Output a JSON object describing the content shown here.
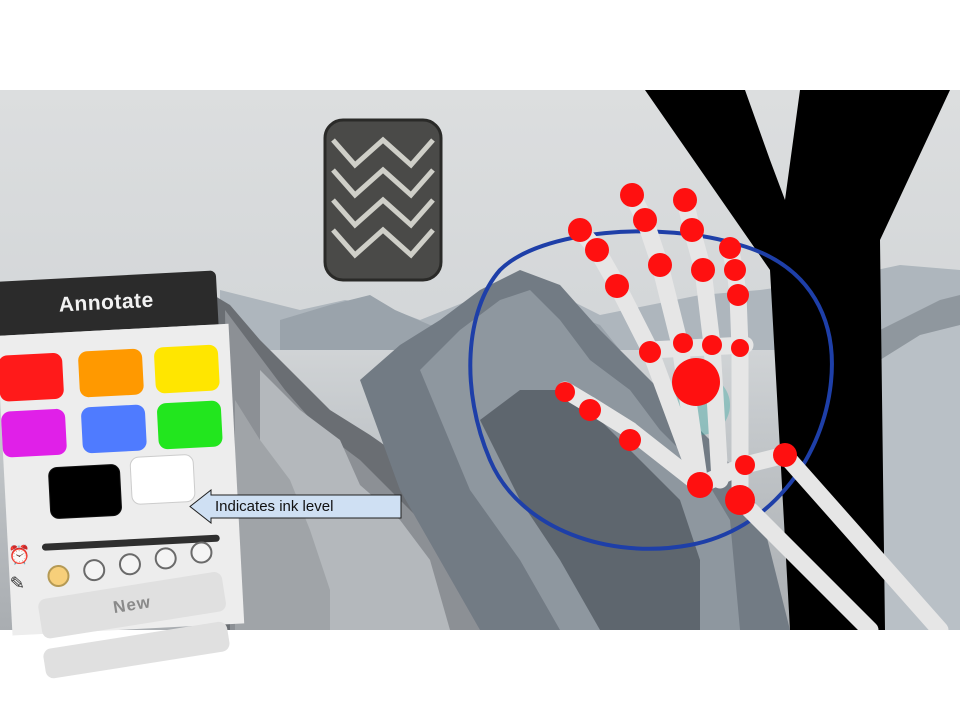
{
  "panel": {
    "title": "Annotate",
    "colors": [
      "#ff1a1a",
      "#ff9900",
      "#ffe600",
      "#e020e8",
      "#4f7bff",
      "#22e61e",
      "#000000",
      "#ffffff"
    ],
    "ink_level": 1.0,
    "pen_sizes_selected_index": 0,
    "new_label": "New"
  },
  "callout": {
    "text": "Indicates ink level"
  },
  "colors": {
    "panel_header": "#2b2b2b",
    "panel_body": "#ededed",
    "callout_fill": "#cfe0f3",
    "callout_stroke": "#1f1f1f",
    "hand_joint": "#ff1010",
    "hand_bone": "#e6e6e6",
    "circle_stroke": "#1e3fa8",
    "selected_size": "#f7cf7a"
  }
}
